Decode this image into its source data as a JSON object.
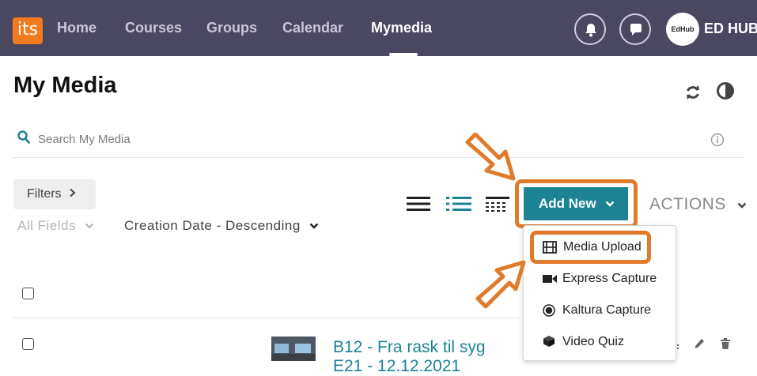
{
  "topbar": {
    "logo_text": "its",
    "nav": [
      "Home",
      "Courses",
      "Groups",
      "Calendar",
      "Mymedia"
    ],
    "active_index": 4,
    "avatar_text": "EdHub",
    "user_name": "ED HUB"
  },
  "page": {
    "title": "My Media"
  },
  "search": {
    "placeholder": "Search My Media"
  },
  "filters": {
    "button_label": "Filters",
    "field_label": "All Fields",
    "sort_label": "Creation Date - Descending"
  },
  "toolbar": {
    "add_new_label": "Add New",
    "actions_label": "ACTIONS"
  },
  "add_new_menu": {
    "items": [
      "Media Upload",
      "Express Capture",
      "Kaltura Capture",
      "Video Quiz"
    ],
    "highlighted_index": 0
  },
  "media_list": {
    "rows": [
      {
        "title": "B12 - Fra rask til syg",
        "subtitle": "E21 - 12.12.2021"
      }
    ]
  },
  "colors": {
    "nav_bg": "#4a4760",
    "brand_orange": "#f27b1f",
    "accent_teal": "#1b8394",
    "highlight_orange": "#e07b2c"
  }
}
